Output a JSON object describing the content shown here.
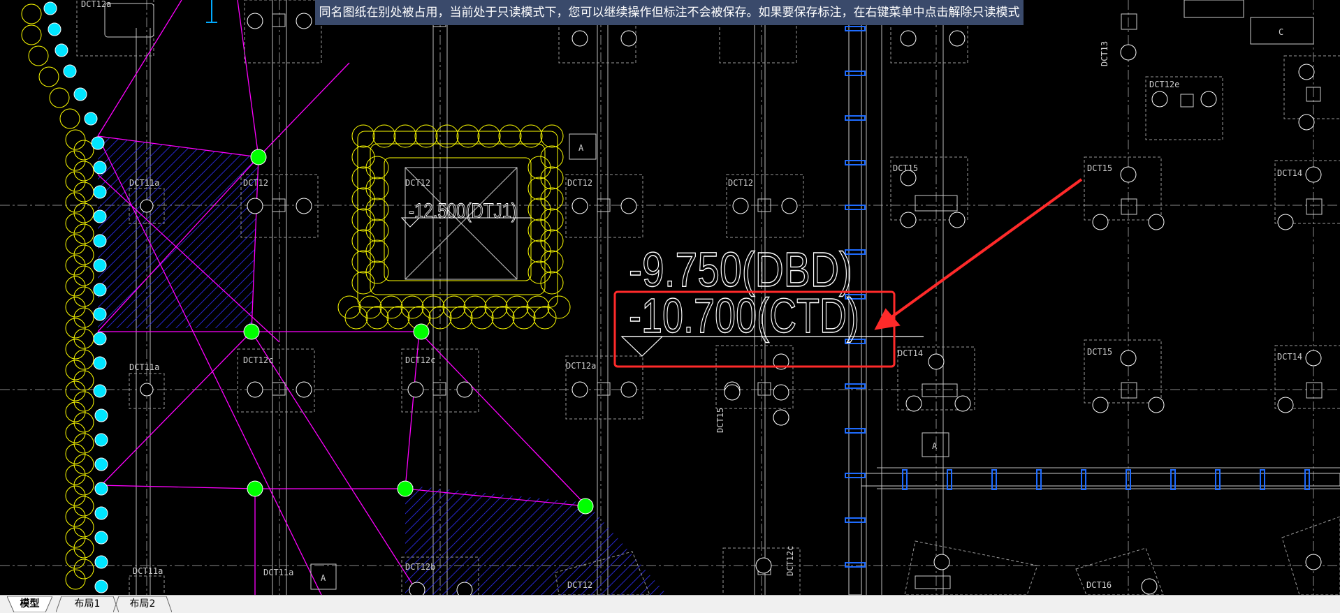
{
  "banner": {
    "text": "同名图纸在别处被占用，当前处于只读模式下，您可以继续操作但标注不会被保存。如果要保存标注，在右键菜单中点击解除只读模式"
  },
  "tabs": [
    {
      "label": "模型",
      "active": true
    },
    {
      "label": "布局1",
      "active": false
    },
    {
      "label": "布局2",
      "active": false
    }
  ],
  "drawing": {
    "elevation_top": "-9.750(DBD)",
    "elevation_bottom": "-10.700(CTD)",
    "elevation_small": "-12.500(DTJ1)",
    "labels": {
      "dct12": "DCT12",
      "dct12c": "DCT12c",
      "dct12b": "DCT12b",
      "dct12a": "DCT12a",
      "dct11a": "DCT11a",
      "dct15": "DCT15",
      "dct14": "DCT14",
      "dct13": "DCT13",
      "dct16": "DCT16",
      "dct12e": "DCT12e",
      "a": "A",
      "c": "C"
    },
    "colors": {
      "annotation": "#ff2a2a",
      "magenta": "#ff00ff",
      "yellow": "#ffff00",
      "cyan": "#00e5ff",
      "green": "#00ff00",
      "hatch": "#3030ff"
    }
  }
}
